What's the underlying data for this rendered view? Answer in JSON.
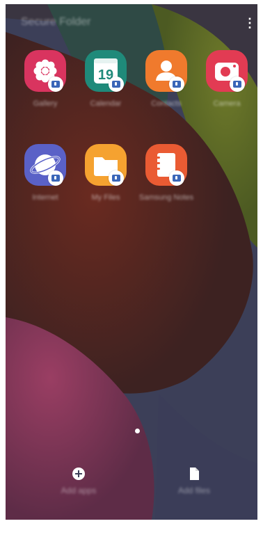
{
  "header": {
    "title": "Secure Folder",
    "menu_icon": "more-vert-icon"
  },
  "apps": [
    {
      "name": "Gallery",
      "icon": "gallery-icon",
      "color": "#d9345f"
    },
    {
      "name": "Calendar",
      "icon": "calendar-icon",
      "color": "#1f8a7a",
      "date": "19"
    },
    {
      "name": "Contacts",
      "icon": "contacts-icon",
      "color": "#f07a2d"
    },
    {
      "name": "Camera",
      "icon": "camera-icon",
      "color": "#e23b53"
    },
    {
      "name": "Internet",
      "icon": "internet-icon",
      "color": "#5a61c7"
    },
    {
      "name": "My Files",
      "icon": "my-files-icon",
      "color": "#f5a230"
    },
    {
      "name": "Samsung Notes",
      "icon": "samsung-notes-icon",
      "color": "#ea5b33"
    }
  ],
  "footer": {
    "add_apps_label": "Add apps",
    "add_files_label": "Add files",
    "corner_text": ""
  },
  "colors": {
    "badge": "#3a66b8"
  }
}
